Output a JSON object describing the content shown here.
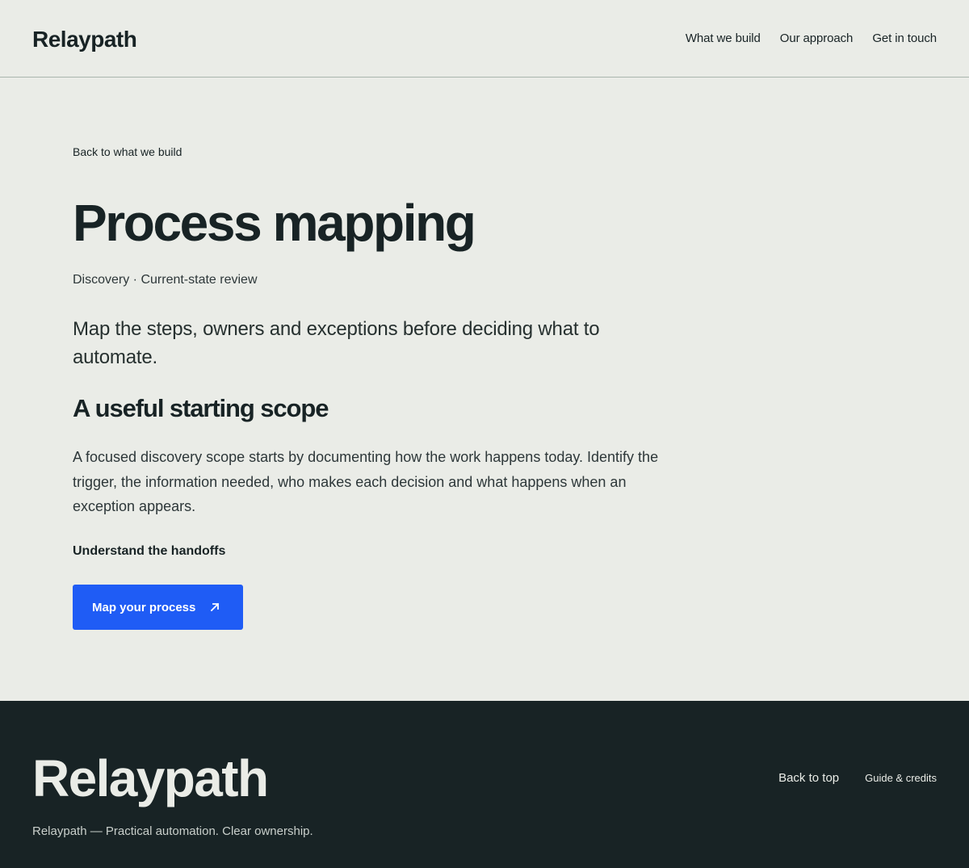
{
  "header": {
    "logo": "Relaypath",
    "nav": [
      {
        "label": "What we build"
      },
      {
        "label": "Our approach"
      },
      {
        "label": "Get in touch"
      }
    ]
  },
  "main": {
    "back_link": "Back to what we build",
    "title": "Process mapping",
    "meta": "Discovery · Current-state review",
    "lede": "Map the steps, owners and exceptions before deciding what to automate.",
    "section_heading": "A useful starting scope",
    "body": "A focused discovery scope starts by documenting how the work happens today. Identify the trigger, the information needed, who makes each decision and what happens when an exception appears.",
    "subheading": "Understand the handoffs",
    "cta": {
      "label": "Map your process",
      "icon": "arrow-up-right-icon"
    }
  },
  "footer": {
    "logo": "Relaypath",
    "tagline": "Relaypath — Practical automation. Clear ownership.",
    "links": [
      {
        "label": "Back to top"
      },
      {
        "label": "Guide & credits"
      }
    ]
  },
  "colors": {
    "background": "#eaece7",
    "text": "#182325",
    "accent": "#1f5cf5",
    "footer_bg": "#182325",
    "divider": "#a9b6ad"
  }
}
